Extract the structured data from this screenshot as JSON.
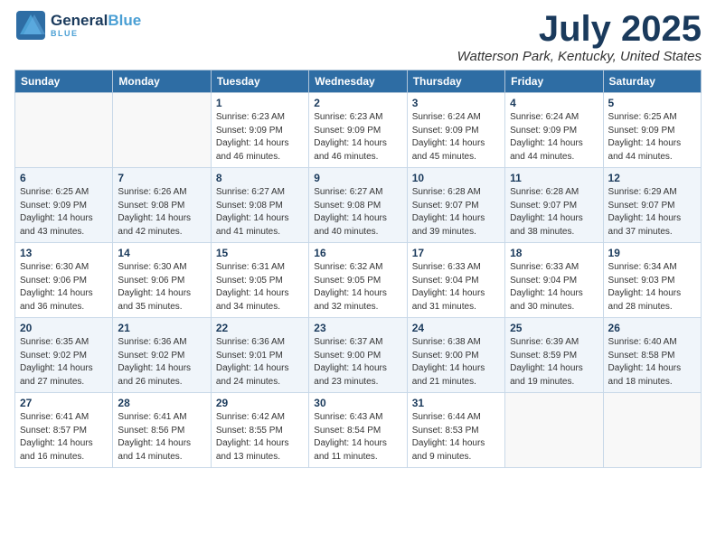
{
  "header": {
    "logo_line1": "General",
    "logo_line2": "Blue",
    "title": "July 2025",
    "location": "Watterson Park, Kentucky, United States"
  },
  "days_of_week": [
    "Sunday",
    "Monday",
    "Tuesday",
    "Wednesday",
    "Thursday",
    "Friday",
    "Saturday"
  ],
  "weeks": [
    [
      {
        "day": "",
        "detail": ""
      },
      {
        "day": "",
        "detail": ""
      },
      {
        "day": "1",
        "detail": "Sunrise: 6:23 AM\nSunset: 9:09 PM\nDaylight: 14 hours and 46 minutes."
      },
      {
        "day": "2",
        "detail": "Sunrise: 6:23 AM\nSunset: 9:09 PM\nDaylight: 14 hours and 46 minutes."
      },
      {
        "day": "3",
        "detail": "Sunrise: 6:24 AM\nSunset: 9:09 PM\nDaylight: 14 hours and 45 minutes."
      },
      {
        "day": "4",
        "detail": "Sunrise: 6:24 AM\nSunset: 9:09 PM\nDaylight: 14 hours and 44 minutes."
      },
      {
        "day": "5",
        "detail": "Sunrise: 6:25 AM\nSunset: 9:09 PM\nDaylight: 14 hours and 44 minutes."
      }
    ],
    [
      {
        "day": "6",
        "detail": "Sunrise: 6:25 AM\nSunset: 9:09 PM\nDaylight: 14 hours and 43 minutes."
      },
      {
        "day": "7",
        "detail": "Sunrise: 6:26 AM\nSunset: 9:08 PM\nDaylight: 14 hours and 42 minutes."
      },
      {
        "day": "8",
        "detail": "Sunrise: 6:27 AM\nSunset: 9:08 PM\nDaylight: 14 hours and 41 minutes."
      },
      {
        "day": "9",
        "detail": "Sunrise: 6:27 AM\nSunset: 9:08 PM\nDaylight: 14 hours and 40 minutes."
      },
      {
        "day": "10",
        "detail": "Sunrise: 6:28 AM\nSunset: 9:07 PM\nDaylight: 14 hours and 39 minutes."
      },
      {
        "day": "11",
        "detail": "Sunrise: 6:28 AM\nSunset: 9:07 PM\nDaylight: 14 hours and 38 minutes."
      },
      {
        "day": "12",
        "detail": "Sunrise: 6:29 AM\nSunset: 9:07 PM\nDaylight: 14 hours and 37 minutes."
      }
    ],
    [
      {
        "day": "13",
        "detail": "Sunrise: 6:30 AM\nSunset: 9:06 PM\nDaylight: 14 hours and 36 minutes."
      },
      {
        "day": "14",
        "detail": "Sunrise: 6:30 AM\nSunset: 9:06 PM\nDaylight: 14 hours and 35 minutes."
      },
      {
        "day": "15",
        "detail": "Sunrise: 6:31 AM\nSunset: 9:05 PM\nDaylight: 14 hours and 34 minutes."
      },
      {
        "day": "16",
        "detail": "Sunrise: 6:32 AM\nSunset: 9:05 PM\nDaylight: 14 hours and 32 minutes."
      },
      {
        "day": "17",
        "detail": "Sunrise: 6:33 AM\nSunset: 9:04 PM\nDaylight: 14 hours and 31 minutes."
      },
      {
        "day": "18",
        "detail": "Sunrise: 6:33 AM\nSunset: 9:04 PM\nDaylight: 14 hours and 30 minutes."
      },
      {
        "day": "19",
        "detail": "Sunrise: 6:34 AM\nSunset: 9:03 PM\nDaylight: 14 hours and 28 minutes."
      }
    ],
    [
      {
        "day": "20",
        "detail": "Sunrise: 6:35 AM\nSunset: 9:02 PM\nDaylight: 14 hours and 27 minutes."
      },
      {
        "day": "21",
        "detail": "Sunrise: 6:36 AM\nSunset: 9:02 PM\nDaylight: 14 hours and 26 minutes."
      },
      {
        "day": "22",
        "detail": "Sunrise: 6:36 AM\nSunset: 9:01 PM\nDaylight: 14 hours and 24 minutes."
      },
      {
        "day": "23",
        "detail": "Sunrise: 6:37 AM\nSunset: 9:00 PM\nDaylight: 14 hours and 23 minutes."
      },
      {
        "day": "24",
        "detail": "Sunrise: 6:38 AM\nSunset: 9:00 PM\nDaylight: 14 hours and 21 minutes."
      },
      {
        "day": "25",
        "detail": "Sunrise: 6:39 AM\nSunset: 8:59 PM\nDaylight: 14 hours and 19 minutes."
      },
      {
        "day": "26",
        "detail": "Sunrise: 6:40 AM\nSunset: 8:58 PM\nDaylight: 14 hours and 18 minutes."
      }
    ],
    [
      {
        "day": "27",
        "detail": "Sunrise: 6:41 AM\nSunset: 8:57 PM\nDaylight: 14 hours and 16 minutes."
      },
      {
        "day": "28",
        "detail": "Sunrise: 6:41 AM\nSunset: 8:56 PM\nDaylight: 14 hours and 14 minutes."
      },
      {
        "day": "29",
        "detail": "Sunrise: 6:42 AM\nSunset: 8:55 PM\nDaylight: 14 hours and 13 minutes."
      },
      {
        "day": "30",
        "detail": "Sunrise: 6:43 AM\nSunset: 8:54 PM\nDaylight: 14 hours and 11 minutes."
      },
      {
        "day": "31",
        "detail": "Sunrise: 6:44 AM\nSunset: 8:53 PM\nDaylight: 14 hours and 9 minutes."
      },
      {
        "day": "",
        "detail": ""
      },
      {
        "day": "",
        "detail": ""
      }
    ]
  ]
}
